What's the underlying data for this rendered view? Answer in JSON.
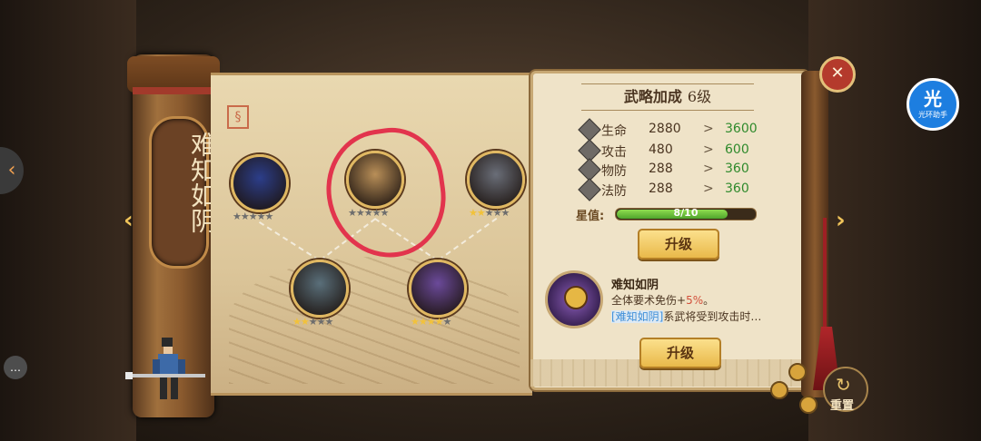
{
  "title": "难知如阴",
  "panel": {
    "heading": "武略加成",
    "level": "6级",
    "stats": [
      {
        "icon": "heart-shield-icon",
        "name": "生命",
        "current": "2880",
        "arrow": ">",
        "next": "3600"
      },
      {
        "icon": "sword-icon",
        "name": "攻击",
        "current": "480",
        "arrow": ">",
        "next": "600"
      },
      {
        "icon": "physical-defense-icon",
        "name": "物防",
        "current": "288",
        "arrow": ">",
        "next": "360"
      },
      {
        "icon": "magic-defense-icon",
        "name": "法防",
        "current": "288",
        "arrow": ">",
        "next": "360"
      }
    ],
    "star_label": "星值:",
    "progress": {
      "current": 8,
      "max": 10,
      "text": "8/10"
    },
    "upgrade_label_1": "升级",
    "skill": {
      "name": "难知如阴",
      "desc_prefix": "全体要术免伤+",
      "desc_pct": "5%",
      "desc_suffix": "。",
      "desc2_tag": "[难知如阴]",
      "desc2_text": "系武将受到攻击时…"
    },
    "upgrade_label_2": "升级"
  },
  "heroes": [
    {
      "id": "hero-locked",
      "stars": 5,
      "stars_on": 0,
      "color": "#2c3e8a"
    },
    {
      "id": "hero-masked",
      "stars": 5,
      "stars_on": 0,
      "color": "#b98f58"
    },
    {
      "id": "hero-elder",
      "stars": 5,
      "stars_on": 2,
      "color": "#6a6e78"
    },
    {
      "id": "hero-scholar",
      "stars": 5,
      "stars_on": 2,
      "color": "#5a6f7a"
    },
    {
      "id": "hero-lady",
      "stars": 5,
      "stars_on": 4,
      "color": "#6b4a9a"
    }
  ],
  "reset_label": "重置",
  "close_icon": "close-icon",
  "badge": {
    "glyph": "光",
    "sub": "光环助手"
  },
  "colors": {
    "accent": "#e9b94a",
    "stat_next": "#2f8a2c",
    "highlight_circle": "#e2344d"
  }
}
